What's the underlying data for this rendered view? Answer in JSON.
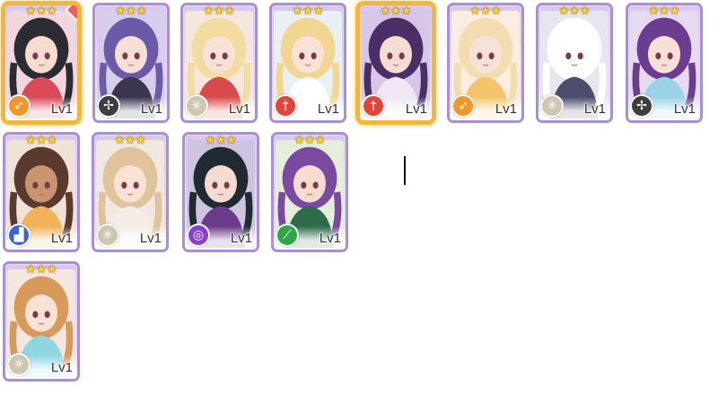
{
  "colors": {
    "star": "#ffd23a",
    "card_border": "#a98fd6",
    "selected_glow": "#f7b733",
    "attr_bow": "#f0962a",
    "attr_wind": "#3e3e3e",
    "attr_sparkle": "#cfc6b0",
    "attr_sword": "#e2443a",
    "attr_boot": "#3a63d6",
    "attr_spiral": "#8a3fd0",
    "attr_staff": "#2fa64a"
  },
  "cards": [
    {
      "level": "Lv1",
      "attribute_icon": "bow-icon",
      "stars": 3,
      "selected": true,
      "new": true,
      "hair": "#2b2b33",
      "skin": "#f6dccf",
      "bg": "#f1d6de",
      "outfit": "#d84a57"
    },
    {
      "level": "Lv1",
      "attribute_icon": "wind-icon",
      "stars": 3,
      "selected": false,
      "new": false,
      "hair": "#6a5aa8",
      "skin": "#f7dfd5",
      "bg": "#d9cdee",
      "outfit": "#3b3550"
    },
    {
      "level": "Lv1",
      "attribute_icon": "sparkle-icon",
      "stars": 3,
      "selected": false,
      "new": false,
      "hair": "#f3dca0",
      "skin": "#f8e2d6",
      "bg": "#f6e6e0",
      "outfit": "#d94b4b"
    },
    {
      "level": "Lv1",
      "attribute_icon": "sword-icon",
      "stars": 3,
      "selected": false,
      "new": false,
      "hair": "#f0d690",
      "skin": "#f8e2d6",
      "bg": "#e8f0f4",
      "outfit": "#ffffff"
    },
    {
      "level": "Lv1",
      "attribute_icon": "sword-icon",
      "stars": 3,
      "selected": true,
      "new": false,
      "hair": "#4a2e66",
      "skin": "#f6dcd2",
      "bg": "#d7c6e8",
      "outfit": "#efe8f4"
    },
    {
      "level": "Lv1",
      "attribute_icon": "bow-icon",
      "stars": 3,
      "selected": false,
      "new": false,
      "hair": "#f3dcb0",
      "skin": "#f8e2d6",
      "bg": "#fbeee0",
      "outfit": "#f3c56a"
    },
    {
      "level": "Lv1",
      "attribute_icon": "sparkle-icon",
      "stars": 3,
      "selected": false,
      "new": false,
      "hair": "#ffffff",
      "skin": "#ffffff",
      "bg": "#e7e6ef",
      "outfit": "#4b4d6b"
    },
    {
      "level": "Lv1",
      "attribute_icon": "wind-icon",
      "stars": 3,
      "selected": false,
      "new": false,
      "hair": "#6a3d8f",
      "skin": "#f8e0d6",
      "bg": "#e6daf0",
      "outfit": "#9ad3e6"
    },
    {
      "level": "Lv1",
      "attribute_icon": "boot-icon",
      "stars": 3,
      "selected": false,
      "new": false,
      "hair": "#5a3a2e",
      "skin": "#c99470",
      "bg": "#f0e2d6",
      "outfit": "#f2b25a"
    },
    {
      "level": "Lv1",
      "attribute_icon": "sparkle-icon",
      "stars": 3,
      "selected": false,
      "new": false,
      "hair": "#e0c39a",
      "skin": "#f8e2d6",
      "bg": "#f2e8e2",
      "outfit": "#f5eee6"
    },
    {
      "level": "Lv1",
      "attribute_icon": "spiral-icon",
      "stars": 3,
      "selected": false,
      "new": false,
      "hair": "#1f2a33",
      "skin": "#f3dccf",
      "bg": "#cfc4df",
      "outfit": "#6a3b8a"
    },
    {
      "level": "Lv1",
      "attribute_icon": "staff-icon",
      "stars": 3,
      "selected": false,
      "new": false,
      "hair": "#7a4aa0",
      "skin": "#f5dccf",
      "bg": "#e4eedb",
      "outfit": "#2d6b4a"
    },
    {
      "level": "Lv1",
      "attribute_icon": "sparkle-icon",
      "stars": 3,
      "selected": false,
      "new": false,
      "hair": "#d89a5a",
      "skin": "#f8e2d6",
      "bg": "#f6e6e0",
      "outfit": "#8fd6e0"
    }
  ]
}
